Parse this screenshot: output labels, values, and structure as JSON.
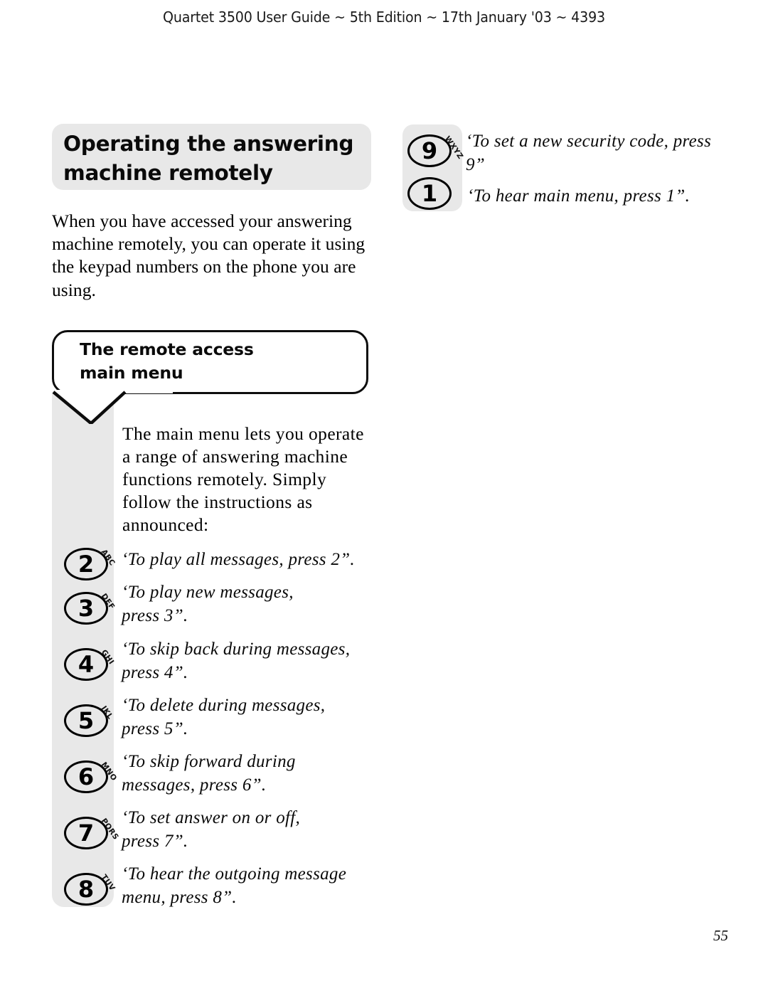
{
  "header": {
    "running_head": "Quartet 3500 User Guide ~ 5th Edition ~ 17th January '03 ~ 4393"
  },
  "heading": {
    "line1": "Operating the answering",
    "line2": "machine remotely"
  },
  "intro": {
    "paragraph": "When you have accessed your answering machine remotely, you can operate it using the keypad numbers on the phone you are using."
  },
  "bubble": {
    "line1": "The remote access",
    "line2": "main menu"
  },
  "menu_intro": {
    "paragraph": "The main menu lets you operate a range of answering machine functions remotely. Simply follow the instructions as announced:"
  },
  "right_column": {
    "keys": [
      {
        "digit": "9",
        "letters": "WXYZ",
        "text": "‘To set a new security code, press 9”"
      },
      {
        "digit": "1",
        "letters": "",
        "text": "‘To hear main menu, press 1”."
      }
    ]
  },
  "main_menu_keys": [
    {
      "digit": "2",
      "letters": "ABC",
      "text": "‘To play all messages, press 2”."
    },
    {
      "digit": "3",
      "letters": "DEF",
      "text": "‘To play new messages, press 3”."
    },
    {
      "digit": "4",
      "letters": "GHI",
      "text": "‘To skip back during messages, press 4”."
    },
    {
      "digit": "5",
      "letters": "JKL",
      "text": "‘To delete during messages, press 5”."
    },
    {
      "digit": "6",
      "letters": "MNO",
      "text": "‘To skip forward during messages, press 6”."
    },
    {
      "digit": "7",
      "letters": "PQRS",
      "text": "‘To set answer on or off, press 7”."
    },
    {
      "digit": "8",
      "letters": "TUV",
      "text": "‘To hear the outgoing message menu, press 8”."
    }
  ],
  "footer": {
    "page_number": "55"
  },
  "colors": {
    "panel_grey": "#e8e8e8",
    "ink": "#000000",
    "page": "#ffffff"
  }
}
